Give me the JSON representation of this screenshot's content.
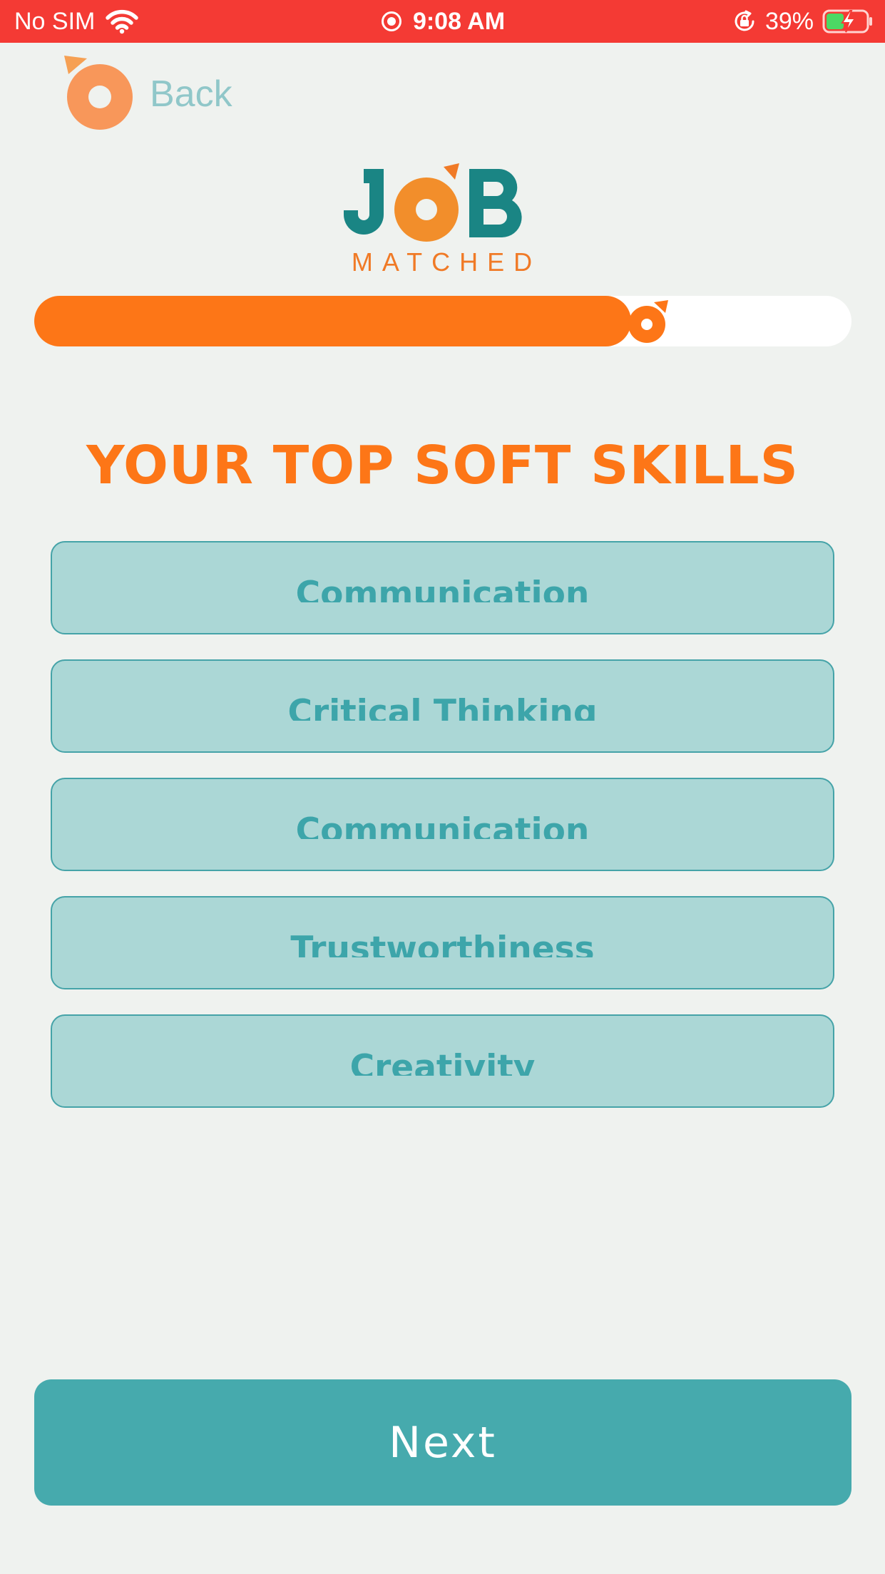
{
  "status_bar": {
    "carrier": "No SIM",
    "time": "9:08 AM",
    "battery_percent": "39%",
    "icons": [
      "wifi-icon",
      "location-icon",
      "orientation-lock-icon",
      "battery-charging-icon"
    ],
    "background_color": "#f43a34"
  },
  "header": {
    "back_label": "Back",
    "back_icon": "orange-logo-icon"
  },
  "logo": {
    "wordmark": "JOB",
    "subtitle": "MATCHED",
    "colors": {
      "teal": "#1a8584",
      "orange": "#f28e2b"
    }
  },
  "progress": {
    "value": 0.73,
    "fill_color": "#fd7617",
    "track_color": "#ffffff",
    "marker_icon": "orange-logo-icon"
  },
  "page_title": "YOUR TOP SOFT SKILLS",
  "skills": [
    "Communication",
    "Critical Thinking",
    "Communication",
    "Trustworthiness",
    "Creativity"
  ],
  "next_label": "Next",
  "colors": {
    "accent": "#fd7617",
    "teal": "#46aaad",
    "skill_bg": "#abd7d6",
    "skill_border": "#45a3a8",
    "background": "#eff2ef"
  }
}
